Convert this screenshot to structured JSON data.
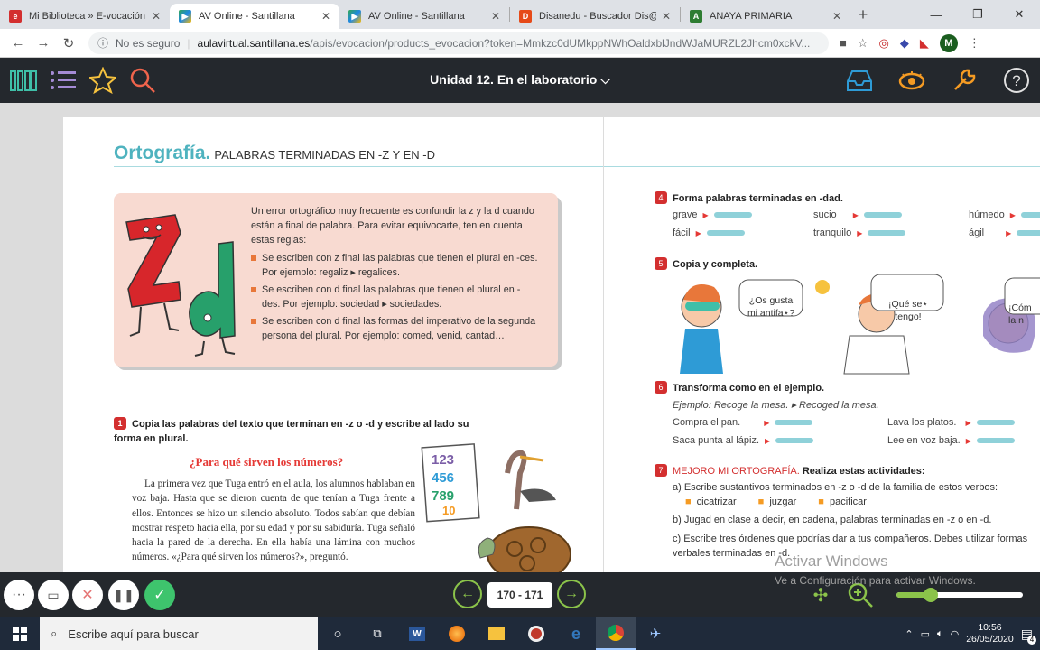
{
  "tabs": [
    {
      "title": "Mi Biblioteca » E-vocación",
      "icon": "e-logo-icon",
      "color": "#d32f2f"
    },
    {
      "title": "AV Online - Santillana",
      "icon": "play-icon",
      "color": "#1e88e5"
    },
    {
      "title": "AV Online - Santillana",
      "icon": "play-icon",
      "color": "#1e88e5"
    },
    {
      "title": "Disanedu - Buscador Dis@",
      "icon": "d-logo-icon",
      "color": "#e64a19"
    },
    {
      "title": "ANAYA PRIMARIA",
      "icon": "a-logo-icon",
      "color": "#2e7d32"
    }
  ],
  "address": {
    "insecure_label": "No es seguro",
    "domain": "aulavirtual.santillana.es",
    "path": "/apis/evocacion/products_evocacion?token=Mmkzc0dUMkppNWhOaldxblJndWJaMURZL2Jhcm0xckV..."
  },
  "profile_initial": "M",
  "appbar": {
    "title": "Unidad 12. En el laboratorio"
  },
  "page_left": {
    "heading": "Ortografía.",
    "subheading": "PALABRAS TERMINADAS EN -Z Y EN -D",
    "rule_intro": "Un error ortográfico muy frecuente es confundir la z y la d cuando están a final de palabra. Para evitar equivocarte, ten en cuenta estas reglas:",
    "rules": [
      "Se escriben con z final las palabras que tienen el plural en -ces. Por ejemplo: regaliz ▸ regalices.",
      "Se escriben con d final las palabras que tienen el plural en -des. Por ejemplo: sociedad ▸ sociedades.",
      "Se escriben con d final las formas del imperativo de la segunda persona del plural. Por ejemplo: comed, venid, cantad…"
    ],
    "exercise1_num": "1",
    "exercise1": "Copia las palabras del texto que terminan en -z o -d y escribe al lado su forma en plural.",
    "story_title": "¿Para qué sirven los números?",
    "story": "La primera vez que Tuga entró en el aula, los alumnos hablaban en voz baja. Hasta que se dieron cuenta de que tenían a Tuga frente a ellos. Entonces se hizo un silencio absoluto. Todos sabían que debían mostrar respeto hacia ella, por su edad y por su sabiduría. Tuga señaló hacia la pared de la derecha. En ella había una lámina con muchos números. «¿Para qué sirven los números?», preguntó."
  },
  "page_right": {
    "ex4_num": "4",
    "ex4": "Forma palabras terminadas en -dad.",
    "ex4_words": [
      "grave",
      "sucio",
      "húmedo",
      "fácil",
      "tranquilo",
      "ágil"
    ],
    "ex5_num": "5",
    "ex5": "Copia y completa.",
    "bubbles": [
      "¿Os gusta mi antifa⋆?",
      "¡Qué se⋆ tengo!",
      "¡Cóm la n"
    ],
    "ex6_num": "6",
    "ex6": "Transforma como en el ejemplo.",
    "ex6_example": "Ejemplo: Recoge la mesa. ▸ Recoged la mesa.",
    "ex6_items": [
      "Compra el pan.",
      "Lava los platos.",
      "Saca punta al lápiz.",
      "Lee en voz baja."
    ],
    "ex7_num": "7",
    "ex7_title": "MEJORO MI ORTOGRAFÍA.",
    "ex7": "Realiza estas actividades:",
    "ex7a": "a)  Escribe sustantivos terminados en -z o -d de la familia de estos verbos:",
    "ex7a_words": [
      "cicatrizar",
      "juzgar",
      "pacificar"
    ],
    "ex7b": "b)  Jugad en clase a decir, en cadena, palabras terminadas en -z o en -d.",
    "ex7c": "c)  Escribe tres órdenes que podrías dar a tus compañeros. Debes utilizar formas verbales terminadas en -d."
  },
  "pager": "170 - 171",
  "zoom_level": 0.27,
  "watermark": {
    "line1": "Activar Windows",
    "line2": "Ve a Configuración para activar Windows."
  },
  "taskbar": {
    "search_placeholder": "Escribe aquí para buscar",
    "time": "10:56",
    "date": "26/05/2020",
    "notifications": "4"
  },
  "colors": {
    "accent": "#8bc34a",
    "appbar": "#24282d",
    "title_teal": "#4fb3bf",
    "red": "#d32f2f"
  }
}
